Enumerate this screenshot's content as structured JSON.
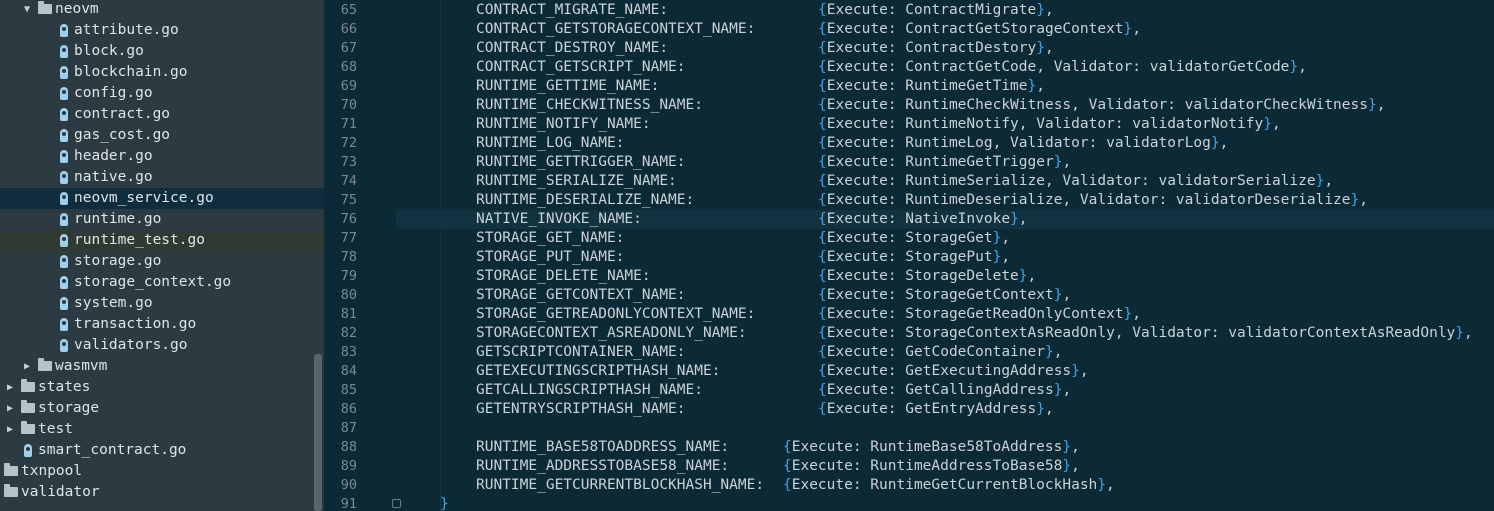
{
  "file_tree": [
    {
      "label": "neovm",
      "type": "folder",
      "depth": 1,
      "expanded": true
    },
    {
      "label": "attribute.go",
      "type": "file",
      "depth": 2
    },
    {
      "label": "block.go",
      "type": "file",
      "depth": 2
    },
    {
      "label": "blockchain.go",
      "type": "file",
      "depth": 2
    },
    {
      "label": "config.go",
      "type": "file",
      "depth": 2
    },
    {
      "label": "contract.go",
      "type": "file",
      "depth": 2
    },
    {
      "label": "gas_cost.go",
      "type": "file",
      "depth": 2
    },
    {
      "label": "header.go",
      "type": "file",
      "depth": 2
    },
    {
      "label": "native.go",
      "type": "file",
      "depth": 2
    },
    {
      "label": "neovm_service.go",
      "type": "file",
      "depth": 2,
      "selected": true
    },
    {
      "label": "runtime.go",
      "type": "file",
      "depth": 2
    },
    {
      "label": "runtime_test.go",
      "type": "file",
      "depth": 2,
      "highlight": true
    },
    {
      "label": "storage.go",
      "type": "file",
      "depth": 2
    },
    {
      "label": "storage_context.go",
      "type": "file",
      "depth": 2
    },
    {
      "label": "system.go",
      "type": "file",
      "depth": 2
    },
    {
      "label": "transaction.go",
      "type": "file",
      "depth": 2
    },
    {
      "label": "validators.go",
      "type": "file",
      "depth": 2
    },
    {
      "label": "wasmvm",
      "type": "folder",
      "depth": 1,
      "expanded": false
    },
    {
      "label": "states",
      "type": "folder",
      "depth": 0,
      "expanded": false
    },
    {
      "label": "storage",
      "type": "folder",
      "depth": 0,
      "expanded": false
    },
    {
      "label": "test",
      "type": "folder",
      "depth": 0,
      "expanded": false
    },
    {
      "label": "smart_contract.go",
      "type": "file",
      "depth": 1
    },
    {
      "label": "txnpool",
      "type": "folder",
      "depth": -1,
      "expanded": null
    },
    {
      "label": "validator",
      "type": "folder",
      "depth": -1,
      "expanded": null
    }
  ],
  "editor": {
    "current_line": "76",
    "lines": [
      {
        "n": "65",
        "key": "CONTRACT_MIGRATE_NAME:",
        "val": "Execute: ContractMigrate",
        "wide": true
      },
      {
        "n": "66",
        "key": "CONTRACT_GETSTORAGECONTEXT_NAME:",
        "val": "Execute: ContractGetStorageContext",
        "wide": true
      },
      {
        "n": "67",
        "key": "CONTRACT_DESTROY_NAME:",
        "val": "Execute: ContractDestory",
        "wide": true
      },
      {
        "n": "68",
        "key": "CONTRACT_GETSCRIPT_NAME:",
        "val": "Execute: ContractGetCode, Validator: validatorGetCode",
        "wide": true
      },
      {
        "n": "69",
        "key": "RUNTIME_GETTIME_NAME:",
        "val": "Execute: RuntimeGetTime",
        "wide": true
      },
      {
        "n": "70",
        "key": "RUNTIME_CHECKWITNESS_NAME:",
        "val": "Execute: RuntimeCheckWitness, Validator: validatorCheckWitness",
        "wide": true
      },
      {
        "n": "71",
        "key": "RUNTIME_NOTIFY_NAME:",
        "val": "Execute: RuntimeNotify, Validator: validatorNotify",
        "wide": true
      },
      {
        "n": "72",
        "key": "RUNTIME_LOG_NAME:",
        "val": "Execute: RuntimeLog, Validator: validatorLog",
        "wide": true
      },
      {
        "n": "73",
        "key": "RUNTIME_GETTRIGGER_NAME:",
        "val": "Execute: RuntimeGetTrigger",
        "wide": true
      },
      {
        "n": "74",
        "key": "RUNTIME_SERIALIZE_NAME:",
        "val": "Execute: RuntimeSerialize, Validator: validatorSerialize",
        "wide": true
      },
      {
        "n": "75",
        "key": "RUNTIME_DESERIALIZE_NAME:",
        "val": "Execute: RuntimeDeserialize, Validator: validatorDeserialize",
        "wide": true
      },
      {
        "n": "76",
        "key": "NATIVE_INVOKE_NAME:",
        "val": "Execute: NativeInvoke",
        "wide": true
      },
      {
        "n": "77",
        "key": "STORAGE_GET_NAME:",
        "val": "Execute: StorageGet",
        "wide": true
      },
      {
        "n": "78",
        "key": "STORAGE_PUT_NAME:",
        "val": "Execute: StoragePut",
        "wide": true
      },
      {
        "n": "79",
        "key": "STORAGE_DELETE_NAME:",
        "val": "Execute: StorageDelete",
        "wide": true
      },
      {
        "n": "80",
        "key": "STORAGE_GETCONTEXT_NAME:",
        "val": "Execute: StorageGetContext",
        "wide": true
      },
      {
        "n": "81",
        "key": "STORAGE_GETREADONLYCONTEXT_NAME:",
        "val": "Execute: StorageGetReadOnlyContext",
        "wide": true
      },
      {
        "n": "82",
        "key": "STORAGECONTEXT_ASREADONLY_NAME:",
        "val": "Execute: StorageContextAsReadOnly, Validator: validatorContextAsReadOnly",
        "wide": true
      },
      {
        "n": "83",
        "key": "GETSCRIPTCONTAINER_NAME:",
        "val": "Execute: GetCodeContainer",
        "wide": true
      },
      {
        "n": "84",
        "key": "GETEXECUTINGSCRIPTHASH_NAME:",
        "val": "Execute: GetExecutingAddress",
        "wide": true
      },
      {
        "n": "85",
        "key": "GETCALLINGSCRIPTHASH_NAME:",
        "val": "Execute: GetCallingAddress",
        "wide": true
      },
      {
        "n": "86",
        "key": "GETENTRYSCRIPTHASH_NAME:",
        "val": "Execute: GetEntryAddress",
        "wide": true
      },
      {
        "n": "87",
        "key": "",
        "val": "",
        "wide": true
      },
      {
        "n": "88",
        "key": "RUNTIME_BASE58TOADDRESS_NAME:",
        "val": "Execute: RuntimeBase58ToAddress",
        "wide": false
      },
      {
        "n": "89",
        "key": "RUNTIME_ADDRESSTOBASE58_NAME:",
        "val": "Execute: RuntimeAddressToBase58",
        "wide": false
      },
      {
        "n": "90",
        "key": "RUNTIME_GETCURRENTBLOCKHASH_NAME:",
        "val": "Execute: RuntimeGetCurrentBlockHash",
        "wide": false
      },
      {
        "n": "91",
        "key": "}",
        "val": "",
        "wide": false,
        "closing": true
      }
    ]
  },
  "colors": {
    "sidebar_bg": "#2c3a41",
    "editor_bg": "#0c2a36",
    "brace": "#3fa4e8",
    "text": "#c9d2d6",
    "line_number": "#7c8a90"
  }
}
